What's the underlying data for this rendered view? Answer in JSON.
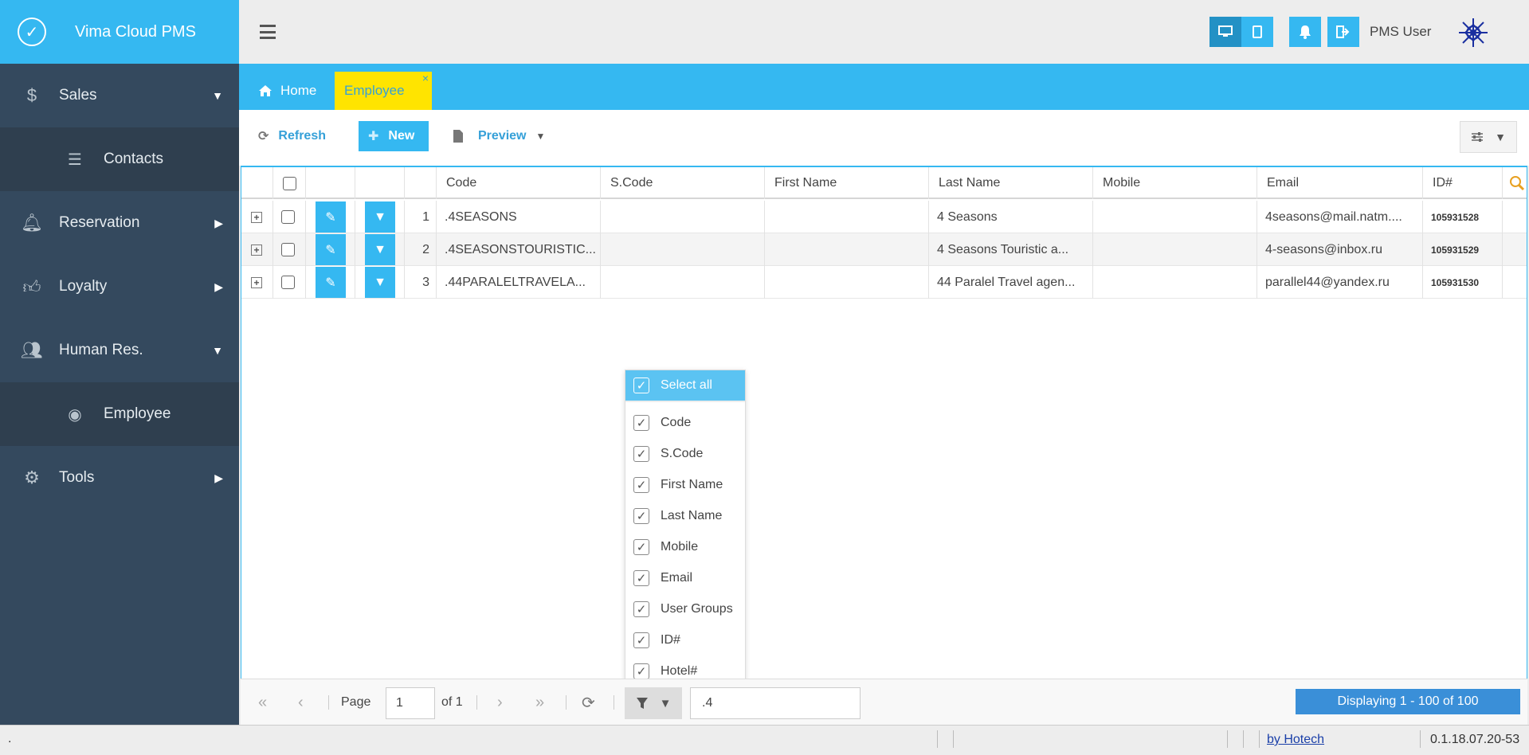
{
  "app": {
    "name": "Vima Cloud PMS"
  },
  "sidebar": {
    "items": [
      {
        "label": "Sales",
        "icon": "dollar-icon",
        "arrow": "down"
      },
      {
        "label": "Contacts",
        "icon": "list-icon",
        "sub": true
      },
      {
        "label": "Reservation",
        "icon": "bell-icon",
        "arrow": "right"
      },
      {
        "label": "Loyalty",
        "icon": "thumbs-up-icon",
        "arrow": "right"
      },
      {
        "label": "Human Res.",
        "icon": "users-icon",
        "arrow": "down"
      },
      {
        "label": "Employee",
        "icon": "user-circle-icon",
        "sub": true
      },
      {
        "label": "Tools",
        "icon": "gears-icon",
        "arrow": "right"
      }
    ]
  },
  "topbar": {
    "user_name": "PMS User"
  },
  "tabs": {
    "home": "Home",
    "employee": "Employee",
    "close": "×"
  },
  "toolbar": {
    "refresh": "Refresh",
    "new": "New",
    "preview": "Preview"
  },
  "grid": {
    "columns": [
      "Code",
      "S.Code",
      "First Name",
      "Last Name",
      "Mobile",
      "Email",
      "ID#"
    ],
    "rows": [
      {
        "num": "1",
        "code": ".4SEASONS",
        "scode": "",
        "first": "",
        "last": "4 Seasons",
        "mobile": "",
        "email": "4seasons@mail.natm....",
        "id": "105931528"
      },
      {
        "num": "2",
        "code": ".4SEASONSTOURISTIC...",
        "scode": "",
        "first": "",
        "last": "4 Seasons Touristic a...",
        "mobile": "",
        "email": "4-seasons@inbox.ru",
        "id": "105931529"
      },
      {
        "num": "3",
        "code": ".44PARALELTRAVELA...",
        "scode": "",
        "first": "",
        "last": "44 Paralel Travel agen...",
        "mobile": "",
        "email": "parallel44@yandex.ru",
        "id": "105931530"
      }
    ]
  },
  "column_picker": {
    "select_all": "Select all",
    "items": [
      "Code",
      "S.Code",
      "First Name",
      "Last Name",
      "Mobile",
      "Email",
      "User Groups",
      "ID#",
      "Hotel#"
    ]
  },
  "pager": {
    "page_label": "Page",
    "page_value": "1",
    "of_label": "of 1",
    "search_value": ".4",
    "display": "Displaying 1 - 100 of 100"
  },
  "status": {
    "left": ".",
    "link": "by Hotech",
    "version": "0.1.18.07.20-53"
  },
  "colors": {
    "accent": "#35b8f1",
    "sidebar": "#34495e",
    "tab_active": "#ffe400",
    "display_badge": "#3a8fd8"
  }
}
